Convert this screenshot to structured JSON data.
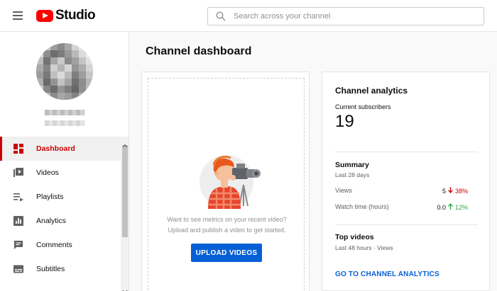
{
  "header": {
    "logo_text": "Studio",
    "search_placeholder": "Search across your channel"
  },
  "sidebar": {
    "items": [
      {
        "label": "Dashboard",
        "icon": "dashboard-icon",
        "active": true
      },
      {
        "label": "Videos",
        "icon": "videos-icon"
      },
      {
        "label": "Playlists",
        "icon": "playlists-icon"
      },
      {
        "label": "Analytics",
        "icon": "analytics-icon"
      },
      {
        "label": "Comments",
        "icon": "comments-icon"
      },
      {
        "label": "Subtitles",
        "icon": "subtitles-icon"
      }
    ]
  },
  "main": {
    "title": "Channel dashboard",
    "upload": {
      "line1": "Want to see metrics on your recent video?",
      "line2": "Upload and publish a video to get started.",
      "button": "UPLOAD VIDEOS"
    },
    "analytics": {
      "title": "Channel analytics",
      "subscribers_label": "Current subscribers",
      "subscribers_value": "19",
      "summary_title": "Summary",
      "summary_period": "Last 28 days",
      "views_label": "Views",
      "views_value": "5",
      "views_change": "38%",
      "watch_label": "Watch time (hours)",
      "watch_value": "0.0",
      "watch_change": "12%",
      "top_title": "Top videos",
      "top_period": "Last 48 hours · Views",
      "link": "GO TO CHANNEL ANALYTICS"
    }
  },
  "colors": {
    "accent": "#cc0000",
    "link": "#065fd4",
    "positive": "#2ba640"
  }
}
